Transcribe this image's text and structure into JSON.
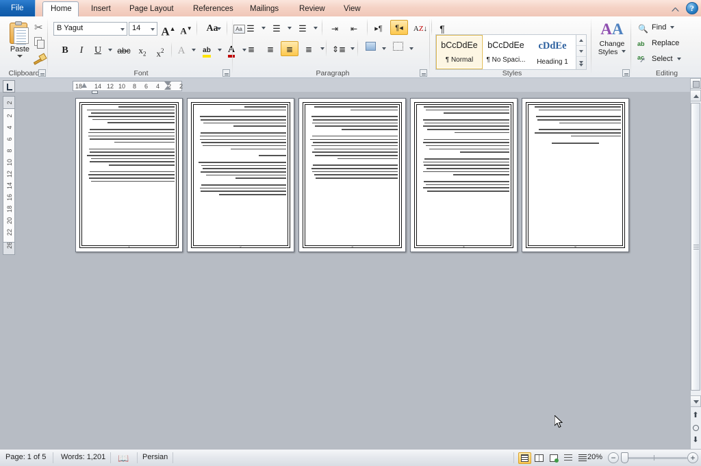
{
  "window": {
    "app": "Microsoft Word",
    "help_label": "?",
    "minimize_ribbon_label": "Minimize the Ribbon"
  },
  "tabs": [
    {
      "id": "file",
      "label": "File",
      "active": false
    },
    {
      "id": "home",
      "label": "Home",
      "active": true
    },
    {
      "id": "insert",
      "label": "Insert",
      "active": false
    },
    {
      "id": "page-layout",
      "label": "Page Layout",
      "active": false
    },
    {
      "id": "references",
      "label": "References",
      "active": false
    },
    {
      "id": "mailings",
      "label": "Mailings",
      "active": false
    },
    {
      "id": "review",
      "label": "Review",
      "active": false
    },
    {
      "id": "view",
      "label": "View",
      "active": false
    }
  ],
  "ribbon": {
    "groups": [
      {
        "id": "clipboard",
        "label": "Clipboard"
      },
      {
        "id": "font",
        "label": "Font"
      },
      {
        "id": "paragraph",
        "label": "Paragraph"
      },
      {
        "id": "styles",
        "label": "Styles"
      },
      {
        "id": "editing",
        "label": "Editing"
      }
    ],
    "clipboard": {
      "paste_label": "Paste",
      "cut_label": "Cut",
      "copy_label": "Copy",
      "format_painter_label": "Format Painter"
    },
    "font": {
      "font_name": "B Yagut",
      "font_name_placeholder": "Font",
      "font_size": "14",
      "font_size_placeholder": "Size",
      "grow_font_label": "A",
      "shrink_font_label": "A",
      "change_case_label": "Aa",
      "clear_formatting_label": "Clear Formatting",
      "bold_label": "B",
      "italic_label": "I",
      "underline_label": "U",
      "strikethrough_label": "abc",
      "subscript_label": "x",
      "subscript_sub": "2",
      "superscript_label": "x",
      "superscript_sup": "2",
      "text_effects_label": "A",
      "highlight_label": "ab",
      "font_color_label": "A"
    },
    "paragraph": {
      "bullets_label": "Bullets",
      "numbering_label": "Numbering",
      "multilevel_label": "Multilevel List",
      "decrease_indent_label": "Decrease Indent",
      "increase_indent_label": "Increase Indent",
      "ltr_label": "Left-to-Right Text Direction",
      "rtl_label": "Right-to-Left Text Direction",
      "sort_label": "Sort",
      "show_marks_label": "Show/Hide ¶",
      "align_left_label": "Align Text Left",
      "align_center_label": "Center",
      "align_right_label": "Align Text Right",
      "justify_label": "Justify",
      "line_spacing_label": "Line and Paragraph Spacing",
      "shading_label": "Shading",
      "borders_label": "Borders",
      "rtl_active": true,
      "align_right_active": true
    },
    "styles": {
      "items": [
        {
          "sample": "bCcDdEe",
          "name": "¶ Normal",
          "selected": true,
          "kind": "normal"
        },
        {
          "sample": "bCcDdEe",
          "name": "¶ No Spaci...",
          "selected": false,
          "kind": "normal"
        },
        {
          "sample": "cDdEe",
          "name": "Heading 1",
          "selected": false,
          "kind": "heading"
        }
      ],
      "change_styles_line1": "Change",
      "change_styles_line2": "Styles"
    },
    "editing": {
      "find_label": "Find",
      "replace_label": "Replace",
      "select_label": "Select"
    }
  },
  "rulers": {
    "tab_selector_label": "L",
    "horizontal_ticks": [
      "18",
      "14",
      "12",
      "10",
      "8",
      "6",
      "4",
      "2",
      "2"
    ],
    "vertical_top_tick": "2",
    "vertical_ticks": [
      "2",
      "4",
      "6",
      "8",
      "10",
      "12",
      "14",
      "16",
      "18",
      "20",
      "22"
    ],
    "vertical_bottom_tick": "26"
  },
  "document": {
    "language_direction": "rtl",
    "page_count": 5,
    "pages": [
      {
        "number": "1",
        "paragraphs": [
          {
            "lines": [
              62,
              96,
              92,
              95,
              90,
              74
            ]
          },
          {
            "lines": [
              93,
              95,
              95,
              93,
              66
            ]
          },
          {
            "lines": [
              94,
              93,
              96,
              92,
              93,
              72
            ]
          },
          {
            "lines": [
              93,
              95,
              94,
              92
            ]
          }
        ],
        "footer": "1"
      },
      {
        "number": "2",
        "paragraphs": [
          {
            "lines": [
              46,
              62
            ]
          },
          {
            "lines": [
              95,
              94,
              91,
              58
            ]
          },
          {
            "lines": [
              94,
              95,
              95,
              93,
              92,
              61
            ]
          },
          {
            "lines": [
              30
            ]
          },
          {
            "lines": [
              96,
              93,
              92,
              94,
              88,
              56
            ]
          },
          {
            "lines": [
              93,
              95,
              94,
              74
            ]
          }
        ],
        "footer": "2"
      },
      {
        "number": "3",
        "paragraphs": [
          {
            "lines": [
              92,
              52
            ]
          },
          {
            "lines": [
              95,
              93,
              94,
              91,
              62
            ]
          },
          {
            "lines": [
              94,
              96,
              93,
              95,
              92,
              94,
              91,
              66
            ]
          },
          {
            "lines": [
              93,
              95,
              94,
              92,
              90
            ]
          }
        ],
        "footer": "3"
      },
      {
        "number": "4",
        "paragraphs": [
          {
            "lines": [
              94,
              92,
              72
            ]
          },
          {
            "lines": [
              95,
              93,
              95,
              90,
              60
            ]
          },
          {
            "lines": [
              94,
              95,
              92,
              88,
              54
            ]
          },
          {
            "lines": [
              93,
              95,
              94,
              91,
              95,
              62
            ]
          },
          {
            "lines": [
              94,
              92,
              95,
              90
            ]
          }
        ],
        "footer": "4"
      },
      {
        "number": "5",
        "paragraphs": [
          {
            "lines": [
              95,
              90
            ]
          },
          {
            "lines": [
              93,
              92,
              68
            ]
          },
          {
            "lines": [
              90,
              95,
              55
            ]
          },
          {
            "lines": []
          }
        ],
        "link_line": true,
        "footer": "5"
      }
    ]
  },
  "statusbar": {
    "page_indicator": "Page: 1 of 5",
    "word_count": "Words: 1,201",
    "proofing_label": "Proofing errors",
    "language": "Persian",
    "views": [
      {
        "id": "print-layout",
        "label": "Print Layout",
        "active": true
      },
      {
        "id": "full-screen-reading",
        "label": "Full Screen Reading",
        "active": false
      },
      {
        "id": "web-layout",
        "label": "Web Layout",
        "active": false
      },
      {
        "id": "outline",
        "label": "Outline",
        "active": false
      },
      {
        "id": "draft",
        "label": "Draft",
        "active": false
      }
    ],
    "zoom_level": "20%",
    "zoom_out_label": "−",
    "zoom_in_label": "+"
  }
}
